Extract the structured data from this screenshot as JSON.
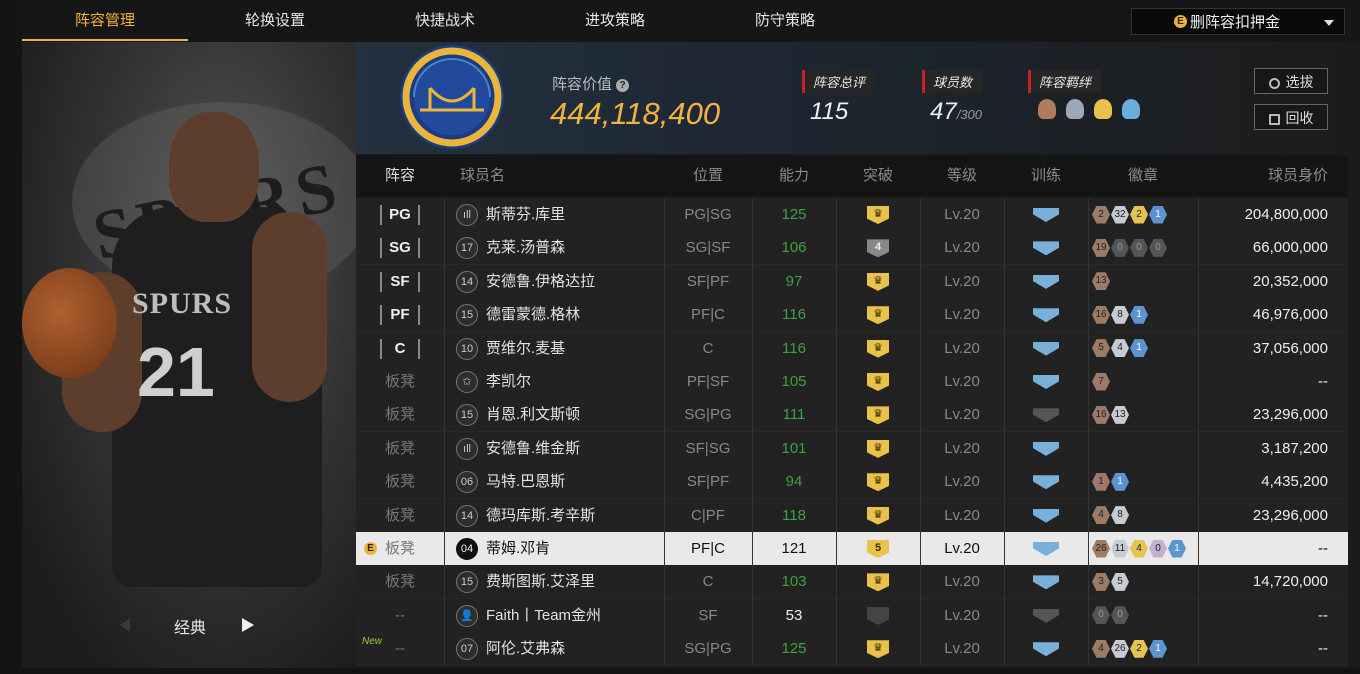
{
  "tabs": [
    {
      "label": "阵容管理",
      "active": true
    },
    {
      "label": "轮换设置",
      "active": false
    },
    {
      "label": "快捷战术",
      "active": false
    },
    {
      "label": "进攻策略",
      "active": false
    },
    {
      "label": "防守策略",
      "active": false
    }
  ],
  "dropdown": {
    "coin_letter": "E",
    "label": "删阵容扣押金"
  },
  "left_panel": {
    "player_jersey_text": "SPURS",
    "player_number": "21",
    "style_label": "经典"
  },
  "header": {
    "value_label": "阵容价值",
    "value_help": "?",
    "value": "444,118,400",
    "stats": [
      {
        "label": "阵容总评",
        "value": "115",
        "suffix": ""
      },
      {
        "label": "球员数",
        "value": "47",
        "suffix": "/300"
      },
      {
        "label": "阵容羁绊",
        "value": "",
        "suffix": ""
      }
    ],
    "buttons": {
      "draft": "选拔",
      "recycle": "回收"
    }
  },
  "columns": [
    "阵容",
    "球员名",
    "位置",
    "能力",
    "突破",
    "等级",
    "训练",
    "徽章",
    "球员身价"
  ],
  "rows": [
    {
      "slot": "PG",
      "starter": true,
      "jersey": "ıll",
      "name": "斯蒂芬.库里",
      "pos": "PG|SG",
      "ability": "125",
      "breakthrough": "crown",
      "level": "Lv.20",
      "train": "on",
      "badges": [
        [
          "b-br",
          "2"
        ],
        [
          "b-sl",
          "32"
        ],
        [
          "b-go",
          "2"
        ],
        [
          "b-bl",
          "1"
        ]
      ],
      "worth": "204,800,000"
    },
    {
      "slot": "SG",
      "starter": true,
      "jersey": "17",
      "name": "克莱.汤普森",
      "pos": "SG|SF",
      "ability": "106",
      "breakthrough": "4",
      "level": "Lv.20",
      "train": "on",
      "badges": [
        [
          "b-br",
          "19"
        ],
        [
          "b-bk",
          "0"
        ],
        [
          "b-bk",
          "0"
        ],
        [
          "b-bk",
          "0"
        ]
      ],
      "worth": "66,000,000"
    },
    {
      "slot": "SF",
      "starter": true,
      "jersey": "14",
      "name": "安德鲁.伊格达拉",
      "pos": "SF|PF",
      "ability": "97",
      "breakthrough": "crown",
      "level": "Lv.20",
      "train": "on",
      "badges": [
        [
          "b-br",
          "13"
        ]
      ],
      "worth": "20,352,000"
    },
    {
      "slot": "PF",
      "starter": true,
      "jersey": "15",
      "name": "德雷蒙德.格林",
      "pos": "PF|C",
      "ability": "116",
      "breakthrough": "crown",
      "level": "Lv.20",
      "train": "on",
      "badges": [
        [
          "b-br",
          "16"
        ],
        [
          "b-sl",
          "8"
        ],
        [
          "b-bl",
          "1"
        ]
      ],
      "worth": "46,976,000"
    },
    {
      "slot": "C",
      "starter": true,
      "jersey": "10",
      "name": "贾维尔.麦基",
      "pos": "C",
      "ability": "116",
      "breakthrough": "crown",
      "level": "Lv.20",
      "train": "on",
      "badges": [
        [
          "b-br",
          "5"
        ],
        [
          "b-sl",
          "4"
        ],
        [
          "b-bl",
          "1"
        ]
      ],
      "worth": "37,056,000"
    },
    {
      "slot": "板凳",
      "starter": false,
      "jersey": "✩",
      "name": "李凯尔",
      "pos": "PF|SF",
      "ability": "105",
      "breakthrough": "crown",
      "level": "Lv.20",
      "train": "on",
      "badges": [
        [
          "b-br",
          "7"
        ]
      ],
      "worth": "--"
    },
    {
      "slot": "板凳",
      "starter": false,
      "jersey": "15",
      "name": "肖恩.利文斯顿",
      "pos": "SG|PG",
      "ability": "111",
      "breakthrough": "crown",
      "level": "Lv.20",
      "train": "dim",
      "badges": [
        [
          "b-br",
          "16"
        ],
        [
          "b-sl",
          "13"
        ]
      ],
      "worth": "23,296,000"
    },
    {
      "slot": "板凳",
      "starter": false,
      "jersey": "ıll",
      "name": "安德鲁.维金斯",
      "pos": "SF|SG",
      "ability": "101",
      "breakthrough": "crown",
      "level": "Lv.20",
      "train": "on",
      "badges": [],
      "worth": "3,187,200"
    },
    {
      "slot": "板凳",
      "starter": false,
      "jersey": "06",
      "name": "马特.巴恩斯",
      "pos": "SF|PF",
      "ability": "94",
      "breakthrough": "crown",
      "level": "Lv.20",
      "train": "on",
      "badges": [
        [
          "b-br",
          "1"
        ],
        [
          "b-bl",
          "1"
        ]
      ],
      "worth": "4,435,200"
    },
    {
      "slot": "板凳",
      "starter": false,
      "jersey": "14",
      "name": "德玛库斯.考辛斯",
      "pos": "C|PF",
      "ability": "118",
      "breakthrough": "crown",
      "level": "Lv.20",
      "train": "on",
      "badges": [
        [
          "b-br",
          "4"
        ],
        [
          "b-sl",
          "8"
        ]
      ],
      "worth": "23,296,000"
    },
    {
      "slot": "板凳",
      "starter": false,
      "selected": true,
      "jersey": "04",
      "name": "蒂姆.邓肯",
      "pos": "PF|C",
      "ability": "121",
      "breakthrough": "5",
      "level": "Lv.20",
      "train": "on",
      "badges": [
        [
          "b-br",
          "26"
        ],
        [
          "b-sl",
          "11"
        ],
        [
          "b-go",
          "4"
        ],
        [
          "b-pu",
          "0"
        ],
        [
          "b-bl",
          "1"
        ]
      ],
      "worth": "--"
    },
    {
      "slot": "板凳",
      "starter": false,
      "jersey": "15",
      "name": "费斯图斯.艾泽里",
      "pos": "C",
      "ability": "103",
      "breakthrough": "crown",
      "level": "Lv.20",
      "train": "on",
      "badges": [
        [
          "b-br",
          "3"
        ],
        [
          "b-sl",
          "5"
        ]
      ],
      "worth": "14,720,000"
    },
    {
      "slot": "--",
      "starter": false,
      "jersey": "👤",
      "name": "Faith丨Team金州",
      "pos": "SF",
      "ability": "53",
      "breakthrough": "dim",
      "level": "Lv.20",
      "train": "dim",
      "badges": [
        [
          "b-bk",
          "0"
        ],
        [
          "b-bk",
          "0"
        ]
      ],
      "worth": "--"
    },
    {
      "slot": "--",
      "starter": false,
      "new": true,
      "jersey": "07",
      "name": "阿伦.艾弗森",
      "pos": "SG|PG",
      "ability": "125",
      "breakthrough": "crown",
      "level": "Lv.20",
      "train": "on",
      "badges": [
        [
          "b-br",
          "4"
        ],
        [
          "b-sl",
          "26"
        ],
        [
          "b-go",
          "2"
        ],
        [
          "b-bl",
          "1"
        ]
      ],
      "worth": "--"
    }
  ],
  "markers": {
    "new_tag": "New",
    "coin_letter": "E"
  },
  "colors": {
    "accent": "#f2b33d",
    "ability_green": "#3fa13f",
    "stat_bar": "#c82128"
  }
}
